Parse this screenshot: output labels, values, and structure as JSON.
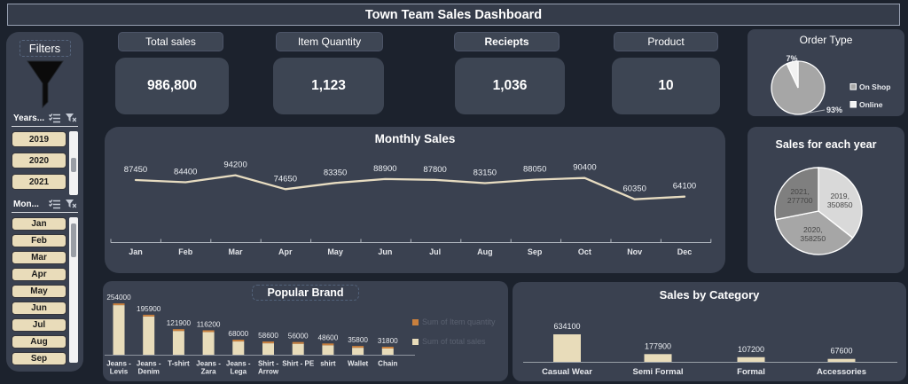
{
  "title": "Town Team Sales Dashboard",
  "filters": {
    "label": "Filters",
    "years": {
      "label": "Years...",
      "items": [
        "2019",
        "2020",
        "2021"
      ]
    },
    "months": {
      "label": "Mon...",
      "items": [
        "Jan",
        "Feb",
        "Mar",
        "Apr",
        "May",
        "Jun",
        "Jul",
        "Aug",
        "Sep"
      ]
    }
  },
  "kpis": [
    {
      "label": "Total sales",
      "value": "986,800"
    },
    {
      "label": "Item Quantity",
      "value": "1,123"
    },
    {
      "label": "Reciepts",
      "value": "1,036",
      "emphasis": true
    },
    {
      "label": "Product",
      "value": "10"
    }
  ],
  "colors": {
    "background": "#1c222d",
    "panel": "#3a4150",
    "accent_tan": "#e8dcba",
    "accent_orange": "#c9803e"
  },
  "chart_data": [
    {
      "id": "order_type",
      "type": "pie",
      "title": "Order Type",
      "labels": [
        "On Shop",
        "Online"
      ],
      "values": [
        93,
        7
      ],
      "unit": "%",
      "colors": [
        "#a6a6a6",
        "#f2f2f2"
      ],
      "legend_position": "right"
    },
    {
      "id": "monthly_sales",
      "type": "line",
      "title": "Monthly Sales",
      "categories": [
        "Jan",
        "Feb",
        "Mar",
        "Apr",
        "May",
        "Jun",
        "Jul",
        "Aug",
        "Sep",
        "Oct",
        "Nov",
        "Dec"
      ],
      "values": [
        87450,
        84400,
        94200,
        74650,
        83350,
        88900,
        87800,
        83150,
        88050,
        90400,
        60350,
        64100
      ],
      "line_color": "#e7dcc1",
      "ylim": [
        0,
        100000
      ],
      "data_labels": true,
      "legend": false
    },
    {
      "id": "sales_for_each_year",
      "type": "pie",
      "title": "Sales for each year",
      "labels": [
        "2019",
        "2020",
        "2021"
      ],
      "values": [
        350850,
        358250,
        277700
      ],
      "colors": [
        "#d9d9d9",
        "#a6a6a6",
        "#7f7f7f"
      ],
      "label_format": "label, value"
    },
    {
      "id": "popular_brand",
      "type": "bar",
      "title": "Popular Brand",
      "categories": [
        "Jeans - Levis",
        "Jeans - Denim",
        "T-shirt",
        "Jeans - Zara",
        "Jeans - Lega",
        "Shirt - Arrow",
        "Shirt - PE",
        "shirt",
        "Wallet",
        "Chain"
      ],
      "categories_lines": [
        [
          "Jeans -",
          "Levis"
        ],
        [
          "Jeans -",
          "Denim"
        ],
        [
          "T-shirt"
        ],
        [
          "Jeans -",
          "Zara"
        ],
        [
          "Jeans -",
          "Lega"
        ],
        [
          "Shirt -",
          "Arrow"
        ],
        [
          "Shirt - PE"
        ],
        [
          "shirt"
        ],
        [
          "Wallet"
        ],
        [
          "Chain"
        ]
      ],
      "values": [
        254000,
        195900,
        121900,
        116200,
        68000,
        58600,
        56000,
        48600,
        35800,
        31800
      ],
      "bar_color": "#e8dcba",
      "cap_color": "#c9803e",
      "series_legend": [
        {
          "name": "Sum of Item quantity",
          "color": "#c9803e"
        },
        {
          "name": "Sum of total sales",
          "color": "#e8dcba"
        }
      ]
    },
    {
      "id": "sales_by_category",
      "type": "bar",
      "title": "Sales by Category",
      "categories": [
        "Casual Wear",
        "Semi Formal",
        "Formal",
        "Accessories"
      ],
      "values": [
        634100,
        177900,
        107200,
        67600
      ],
      "bar_color": "#e8dcba"
    }
  ]
}
